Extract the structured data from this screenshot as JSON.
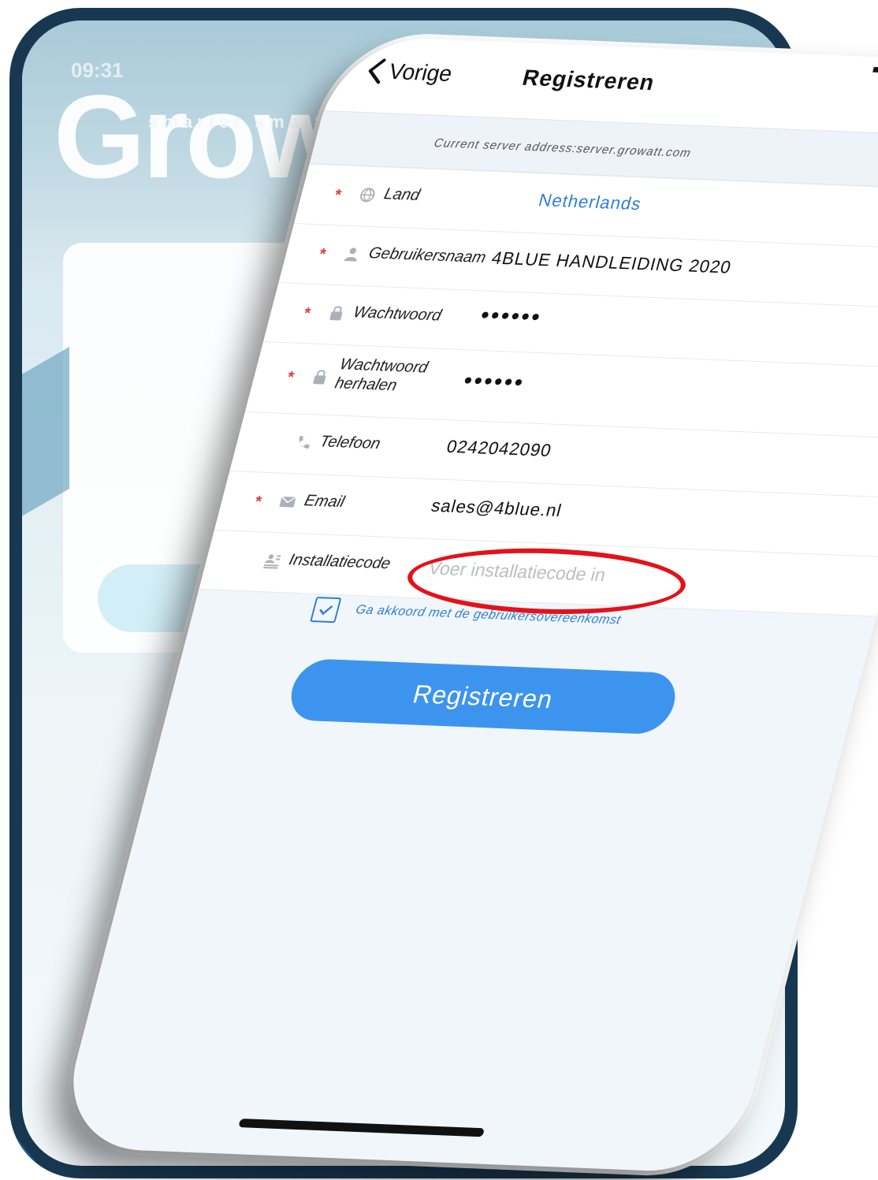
{
  "background_app": {
    "time": "09:31",
    "logo_text": "Growat",
    "slogan": "smarter smart"
  },
  "status_bar": {
    "icons": [
      "signal-icon",
      "wifi-icon",
      "battery-icon"
    ]
  },
  "nav": {
    "back_label": "Vorige",
    "title": "Registreren"
  },
  "server": {
    "text": "Current server address:server.growatt.com"
  },
  "form": {
    "fields": [
      {
        "id": "land",
        "label": "Land",
        "value": "Netherlands",
        "required": true,
        "icon": "globe-icon"
      },
      {
        "id": "gebruikersnaam",
        "label": "Gebruikersnaam",
        "value": "4BLUE HANDLEIDING 2020",
        "required": true,
        "icon": "user-icon"
      },
      {
        "id": "wachtwoord",
        "label": "Wachtwoord",
        "value": "••••••",
        "required": true,
        "icon": "lock-icon"
      },
      {
        "id": "wachtwoord_herhalen",
        "label": "Wachtwoord herhalen",
        "value": "••••••",
        "required": true,
        "icon": "lock-icon"
      },
      {
        "id": "telefoon",
        "label": "Telefoon",
        "value": "0242042090",
        "required": false,
        "icon": "phone-icon"
      },
      {
        "id": "email",
        "label": "Email",
        "value": "sales@4blue.nl",
        "required": true,
        "icon": "mail-icon"
      },
      {
        "id": "installatiecode",
        "label": "Installatiecode",
        "value": "",
        "placeholder": "Voer installatiecode in",
        "required": false,
        "icon": "id-card-icon"
      }
    ],
    "required_mark": "*"
  },
  "agreement": {
    "checked": true,
    "text": "Ga akkoord met de gebruikersovereenkomst"
  },
  "register_button": {
    "label": "Registreren"
  },
  "colors": {
    "accent": "#3d94ef",
    "link": "#2f7fd6",
    "required": "#e53935",
    "highlight": "#e3121b",
    "bezel": "#183852"
  }
}
